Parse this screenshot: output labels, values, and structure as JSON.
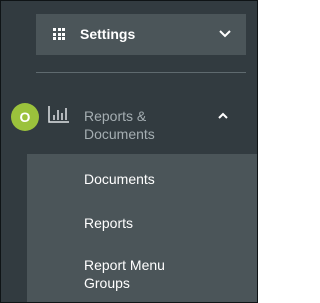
{
  "sidebar": {
    "settings": {
      "label": "Settings",
      "icon": "grid-icon",
      "expanded": false
    },
    "reports": {
      "avatar_letter": "O",
      "avatar_color": "#9bc23c",
      "icon": "bar-chart-icon",
      "label_line1": "Reports &",
      "label_line2": "Documents",
      "expanded": true,
      "items": [
        {
          "label": "Documents"
        },
        {
          "label": "Reports"
        },
        {
          "label_line1": "Report Menu",
          "label_line2": "Groups"
        }
      ]
    }
  },
  "colors": {
    "background": "#323b40",
    "panel": "#4b5559",
    "muted_text": "#a5aeb2",
    "text": "#ffffff"
  }
}
